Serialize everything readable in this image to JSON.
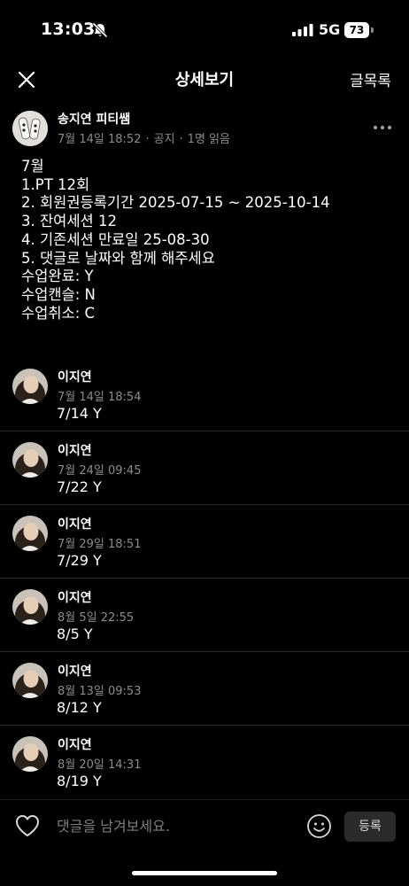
{
  "status_bar": {
    "time": "13:03",
    "network": "5G",
    "battery": "73",
    "icons": [
      "bell-slash-icon",
      "signal-icon",
      "battery-icon"
    ]
  },
  "header": {
    "title": "상세보기",
    "list_link": "글목록",
    "icons": [
      "close-icon"
    ]
  },
  "post": {
    "author": "송지연 피티쌤",
    "date": "7월 14일 18:52",
    "type": "공지",
    "read_count": "1명 읽음",
    "separator": "·",
    "icons": [
      "more-icon"
    ],
    "body_lines": [
      "7월",
      "1.PT 12회",
      "2. 회원권등록기간 2025-07-15 ~ 2025-10-14",
      "3. 잔여세션 12",
      "4. 기존세션 만료일 25-08-30",
      "5. 댓글로 날짜와 함께 해주세요",
      "수업완료: Y",
      "수업캔슬: N",
      "수업취소: C"
    ]
  },
  "comments": [
    {
      "author": "이지연",
      "time": "7월 14일 18:54",
      "text": "7/14 Y"
    },
    {
      "author": "이지연",
      "time": "7월 24일 09:45",
      "text": "7/22 Y"
    },
    {
      "author": "이지연",
      "time": "7월 29일 18:51",
      "text": "7/29 Y"
    },
    {
      "author": "이지연",
      "time": "8월 5일 22:55",
      "text": "8/5 Y"
    },
    {
      "author": "이지연",
      "time": "8월 13일 09:53",
      "text": "8/12 Y"
    },
    {
      "author": "이지연",
      "time": "8월 20일 14:31",
      "text": "8/19 Y"
    }
  ],
  "composer": {
    "placeholder": "댓글을 남겨보세요.",
    "submit_label": "등록",
    "icons": [
      "heart-icon",
      "emoji-icon"
    ]
  },
  "colors": {
    "background": "#000000",
    "text": "#ffffff",
    "muted": "#8c8c8c",
    "divider": "#2a2a2a",
    "button_bg": "#2b2b2b"
  }
}
